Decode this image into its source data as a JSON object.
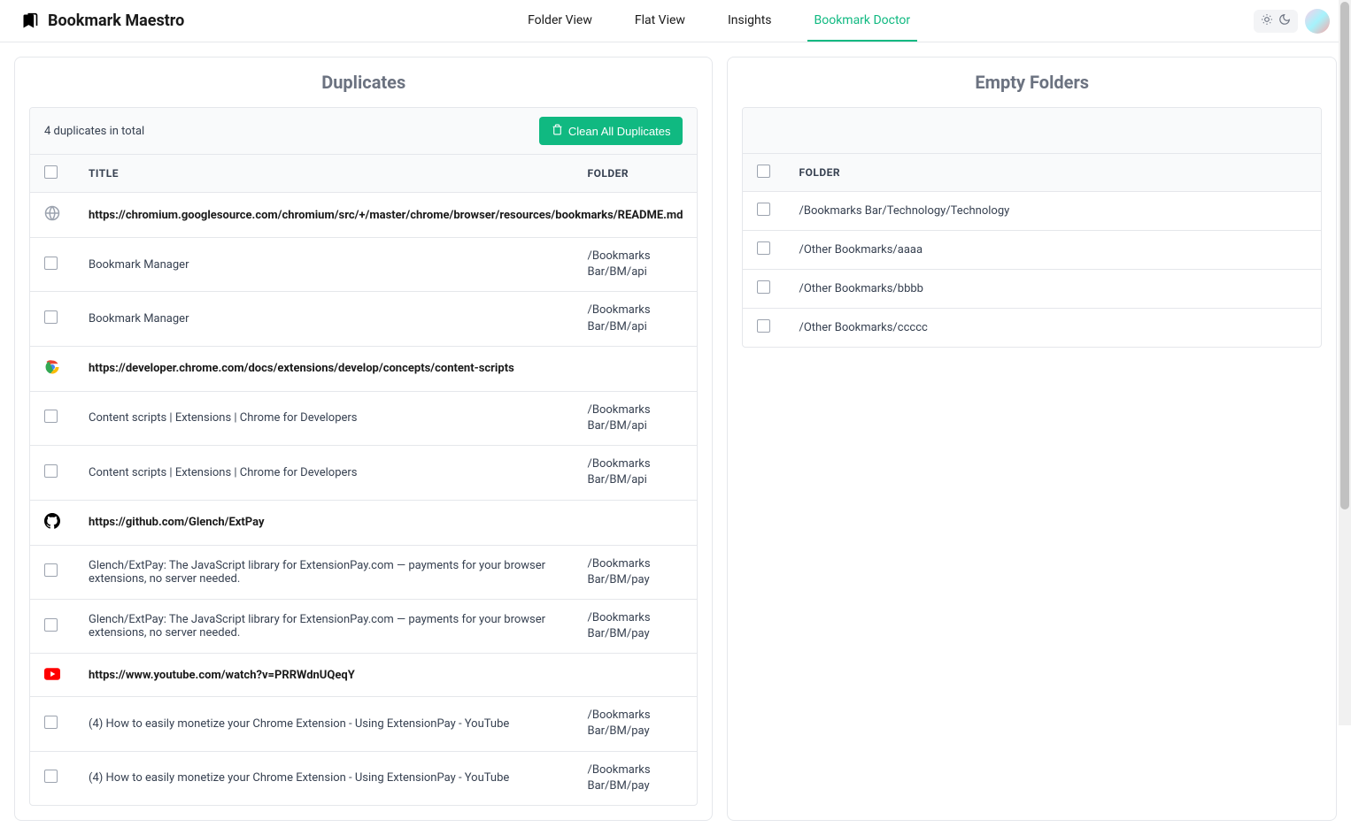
{
  "app": {
    "title": "Bookmark Maestro"
  },
  "nav": {
    "tabs": [
      {
        "label": "Folder View",
        "active": false
      },
      {
        "label": "Flat View",
        "active": false
      },
      {
        "label": "Insights",
        "active": false
      },
      {
        "label": "Bookmark Doctor",
        "active": true
      }
    ]
  },
  "duplicates": {
    "panel_title": "Duplicates",
    "summary": "4 duplicates in total",
    "clean_button": "Clean All Duplicates",
    "columns": {
      "title": "TITLE",
      "folder": "FOLDER"
    },
    "groups": [
      {
        "icon": "globe",
        "url": "https://chromium.googlesource.com/chromium/src/+/master/chrome/browser/resources/bookmarks/README.md",
        "items": [
          {
            "title": "Bookmark Manager",
            "folder": "/Bookmarks Bar/BM/api"
          },
          {
            "title": "Bookmark Manager",
            "folder": "/Bookmarks Bar/BM/api"
          }
        ]
      },
      {
        "icon": "chrome",
        "url": "https://developer.chrome.com/docs/extensions/develop/concepts/content-scripts",
        "items": [
          {
            "title": "Content scripts  |  Extensions  |  Chrome for Developers",
            "folder": "/Bookmarks Bar/BM/api"
          },
          {
            "title": "Content scripts  |  Extensions  |  Chrome for Developers",
            "folder": "/Bookmarks Bar/BM/api"
          }
        ]
      },
      {
        "icon": "github",
        "url": "https://github.com/Glench/ExtPay",
        "items": [
          {
            "title": "Glench/ExtPay: The JavaScript library for ExtensionPay.com — payments for your browser extensions, no server needed.",
            "folder": "/Bookmarks Bar/BM/pay"
          },
          {
            "title": "Glench/ExtPay: The JavaScript library for ExtensionPay.com — payments for your browser extensions, no server needed.",
            "folder": "/Bookmarks Bar/BM/pay"
          }
        ]
      },
      {
        "icon": "youtube",
        "url": "https://www.youtube.com/watch?v=PRRWdnUQeqY",
        "items": [
          {
            "title": "(4) How to easily monetize your Chrome Extension - Using ExtensionPay - YouTube",
            "folder": "/Bookmarks Bar/BM/pay"
          },
          {
            "title": "(4) How to easily monetize your Chrome Extension - Using ExtensionPay - YouTube",
            "folder": "/Bookmarks Bar/BM/pay"
          }
        ]
      }
    ]
  },
  "empty_folders": {
    "panel_title": "Empty Folders",
    "columns": {
      "folder": "FOLDER"
    },
    "items": [
      {
        "path": "/Bookmarks Bar/Technology/Technology"
      },
      {
        "path": "/Other Bookmarks/aaaa"
      },
      {
        "path": "/Other Bookmarks/bbbb"
      },
      {
        "path": "/Other Bookmarks/ccccc"
      }
    ]
  }
}
